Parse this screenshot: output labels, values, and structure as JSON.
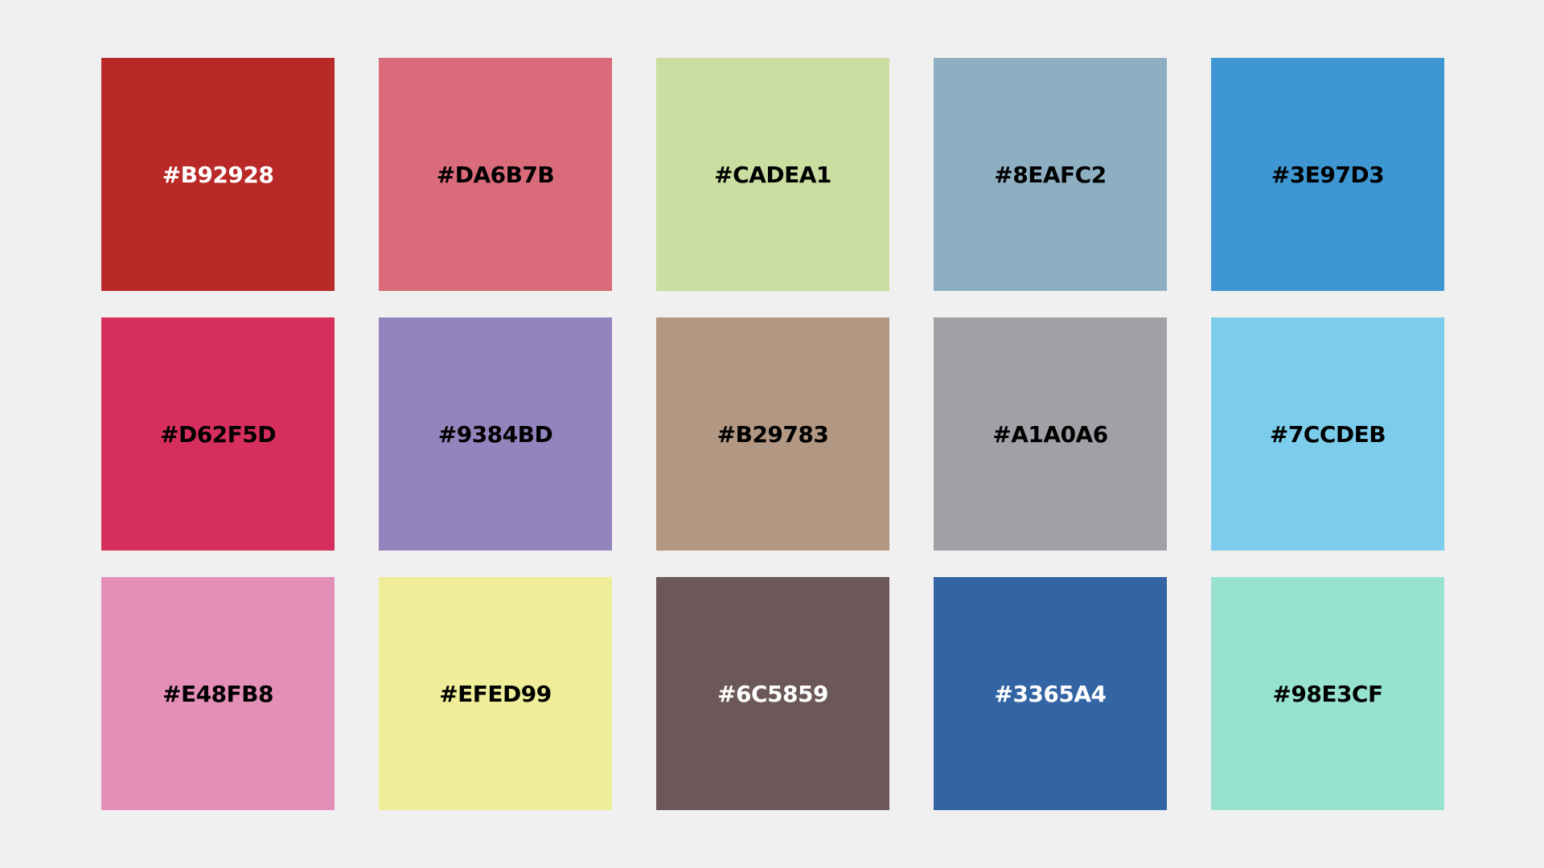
{
  "swatches": [
    {
      "label": "#B92928",
      "color": "#B92928",
      "text_color": "#FFFFFF"
    },
    {
      "label": "#DA6B7B",
      "color": "#DA6B7B",
      "text_color": "#000000"
    },
    {
      "label": "#CADEA1",
      "color": "#CADEA1",
      "text_color": "#000000"
    },
    {
      "label": "#8EAFC2",
      "color": "#8EAFC2",
      "text_color": "#000000"
    },
    {
      "label": "#3E97D3",
      "color": "#3E97D3",
      "text_color": "#000000"
    },
    {
      "label": "#D62F5D",
      "color": "#D62F5D",
      "text_color": "#000000"
    },
    {
      "label": "#9384BD",
      "color": "#9384BD",
      "text_color": "#000000"
    },
    {
      "label": "#B29783",
      "color": "#B29783",
      "text_color": "#000000"
    },
    {
      "label": "#A1A0A6",
      "color": "#A1A0A6",
      "text_color": "#000000"
    },
    {
      "label": "#7CCDEB",
      "color": "#7CCDEB",
      "text_color": "#000000"
    },
    {
      "label": "#E48FB8",
      "color": "#E48FB8",
      "text_color": "#000000"
    },
    {
      "label": "#EFED99",
      "color": "#EFED99",
      "text_color": "#000000"
    },
    {
      "label": "#6C5859",
      "color": "#6C5859",
      "text_color": "#FFFFFF"
    },
    {
      "label": "#3365A4",
      "color": "#3365A4",
      "text_color": "#FFFFFF"
    },
    {
      "label": "#98E3CF",
      "color": "#98E3CF",
      "text_color": "#000000"
    }
  ]
}
